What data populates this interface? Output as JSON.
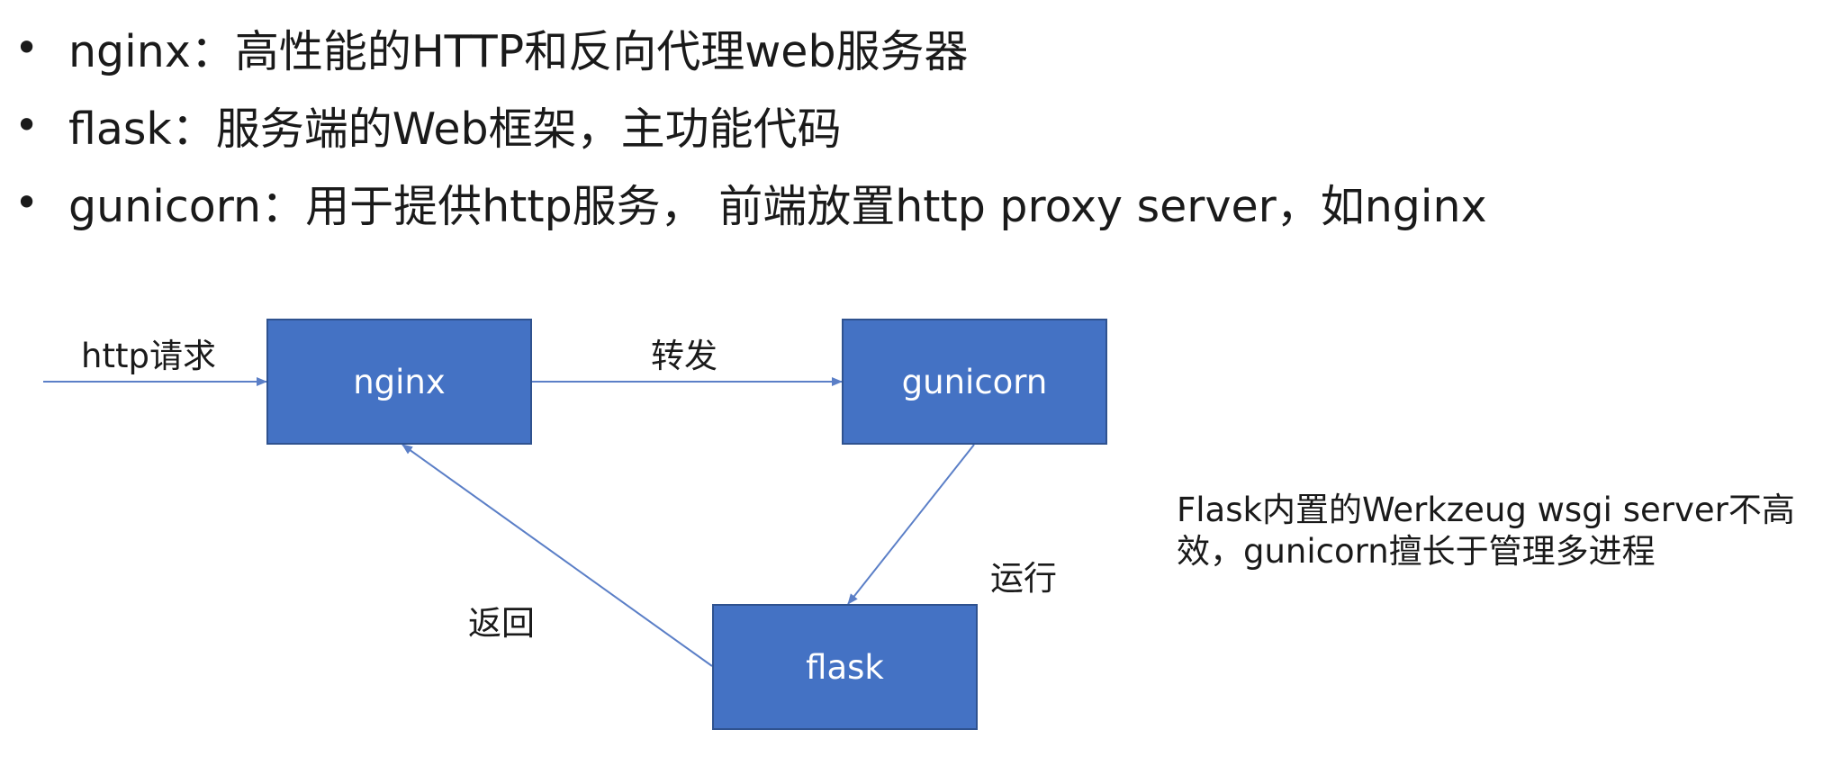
{
  "bullets": [
    {
      "text": "nginx：高性能的HTTP和反向代理web服务器"
    },
    {
      "text": "flask：服务端的Web框架，主功能代码"
    },
    {
      "text": "gunicorn：用于提供http服务， 前端放置http proxy server，如nginx"
    }
  ],
  "bullet_symbol": "•",
  "diagram": {
    "nodes": {
      "nginx": "nginx",
      "gunicorn": "gunicorn",
      "flask": "flask"
    },
    "edge_labels": {
      "http_request": "http请求",
      "forward": "转发",
      "run": "运行",
      "return": "返回"
    },
    "note_lines": [
      "Flask内置的Werkzeug wsgi server不高",
      "效，gunicorn擅长于管理多进程"
    ],
    "colors": {
      "box_fill": "#4472c4",
      "box_border": "#2f528f",
      "arrow": "#5b7fc7"
    }
  }
}
